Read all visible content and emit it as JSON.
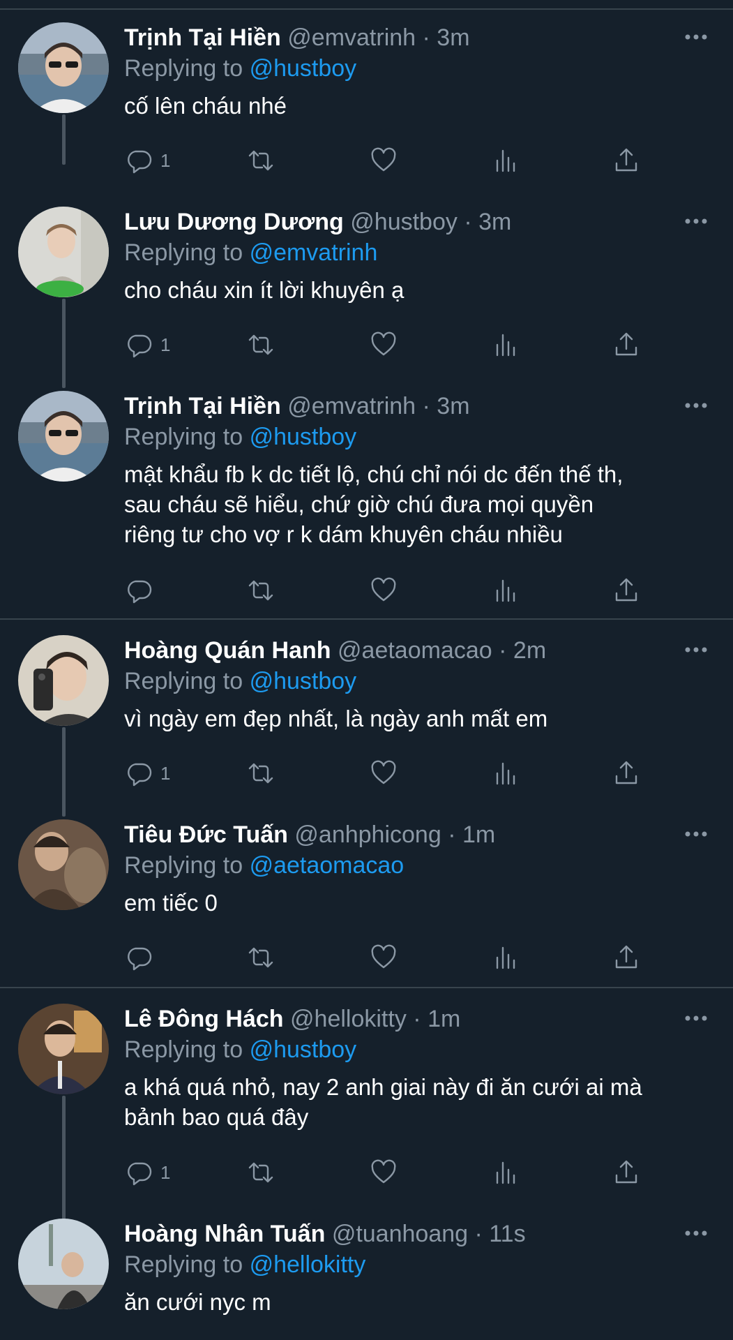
{
  "theme": {
    "background": "#15202b",
    "text": "#ffffff",
    "muted": "#8b98a5",
    "accent": "#1d9bf0",
    "divider": "#38444d"
  },
  "labels": {
    "replying_to": "Replying to"
  },
  "tweets": [
    {
      "name": "Trịnh Tại Hiền",
      "handle": "@emvatrinh",
      "separator": "·",
      "time": "3m",
      "replying_to": "@hustboy",
      "text": [
        "cố lên cháu nhé"
      ],
      "reply_count": "1",
      "avatar_icon": "avatar-photo"
    },
    {
      "name": "Lưu Dương Dương",
      "handle": "@hustboy",
      "separator": "·",
      "time": "3m",
      "replying_to": "@emvatrinh",
      "text": [
        "cho cháu xin ít lời khuyên ạ"
      ],
      "reply_count": "1",
      "avatar_icon": "avatar-photo"
    },
    {
      "name": "Trịnh Tại Hiền",
      "handle": "@emvatrinh",
      "separator": "·",
      "time": "3m",
      "replying_to": "@hustboy",
      "text": [
        "mật khẩu fb k dc tiết lộ, chú chỉ nói dc đến thế th,",
        "sau cháu sẽ hiểu, chứ giờ chú đưa mọi quyền",
        "riêng tư cho vợ r k dám khuyên cháu nhiều"
      ],
      "reply_count": "",
      "avatar_icon": "avatar-photo"
    },
    {
      "name": "Hoàng Quán Hanh",
      "handle": "@aetaomacao",
      "separator": "·",
      "time": "2m",
      "replying_to": "@hustboy",
      "text": [
        "vì ngày em đẹp nhất, là ngày anh mất em"
      ],
      "reply_count": "1",
      "avatar_icon": "avatar-photo"
    },
    {
      "name": "Tiêu Đức Tuấn",
      "handle": "@anhphicong",
      "separator": "·",
      "time": "1m",
      "replying_to": "@aetaomacao",
      "text": [
        "em tiếc 0"
      ],
      "reply_count": "",
      "avatar_icon": "avatar-photo"
    },
    {
      "name": "Lê Đông Hách",
      "handle": "@hellokitty",
      "separator": "·",
      "time": "1m",
      "replying_to": "@hustboy",
      "text": [
        "a khá quá nhỏ, nay 2 anh giai này đi ăn cưới ai mà",
        "bảnh bao quá đây"
      ],
      "reply_count": "1",
      "avatar_icon": "avatar-photo"
    },
    {
      "name": "Hoàng Nhân Tuấn",
      "handle": "@tuanhoang",
      "separator": "·",
      "time": "11s",
      "replying_to": "@hellokitty",
      "text": [
        "ăn cưới nyc m"
      ],
      "reply_count": "",
      "avatar_icon": "avatar-photo"
    }
  ]
}
